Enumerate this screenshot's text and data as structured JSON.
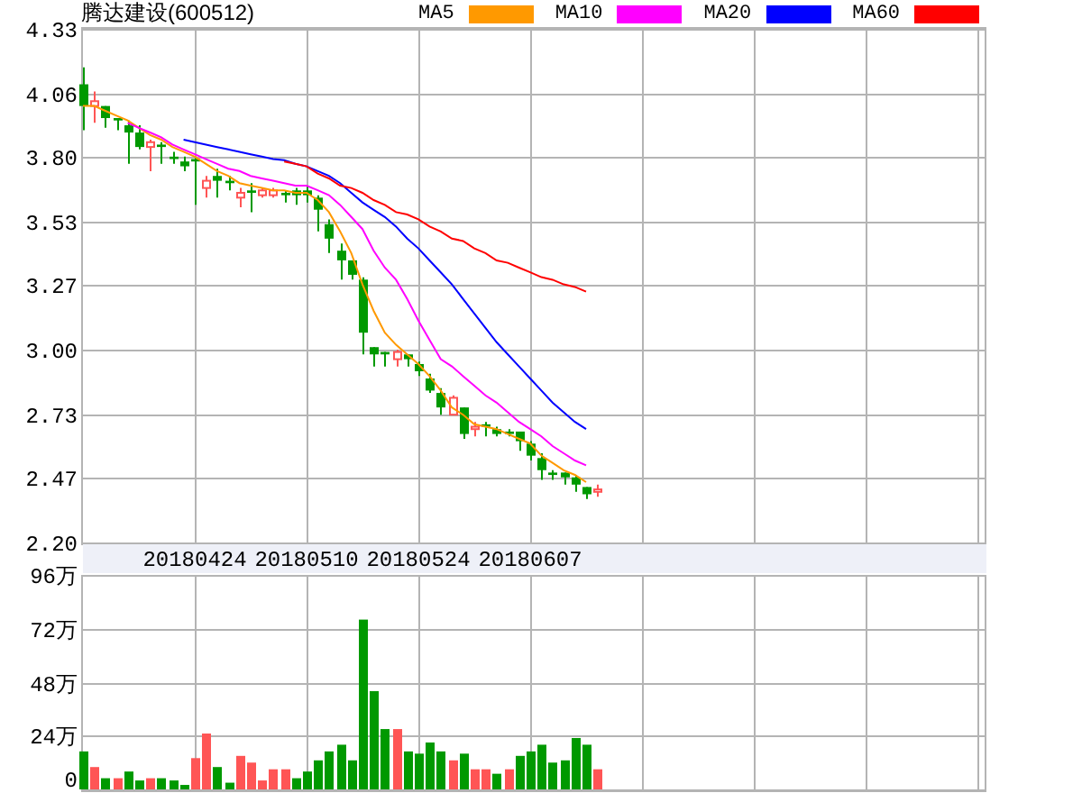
{
  "price_chart": {
    "candles": {
      "chart_data": {
        "type": "candlestick",
        "title": "腾达建设(600512)",
        "grid": true,
        "categories": [
          null,
          null,
          null,
          null,
          null,
          null,
          null,
          null,
          null,
          null,
          "20180424",
          null,
          null,
          null,
          null,
          null,
          null,
          null,
          null,
          null,
          "20180510",
          null,
          null,
          null,
          null,
          null,
          null,
          null,
          null,
          null,
          "20180524",
          null,
          null,
          null,
          null,
          null,
          null,
          null,
          null,
          null,
          "20180607",
          null,
          null,
          null,
          null,
          null,
          null
        ],
        "ylim": [
          2.2,
          4.33
        ],
        "yticks": [
          {
            "value": 4.33,
            "label": "4.33"
          },
          {
            "value": 4.06,
            "label": "4.06"
          },
          {
            "value": 3.8,
            "label": "3.80"
          },
          {
            "value": 3.53,
            "label": "3.53"
          },
          {
            "value": 3.27,
            "label": "3.27"
          },
          {
            "value": 3.0,
            "label": "3.00"
          },
          {
            "value": 2.73,
            "label": "2.73"
          },
          {
            "value": 2.47,
            "label": "2.47"
          },
          {
            "value": 2.2,
            "label": "2.20"
          }
        ],
        "ohlc": [
          [
            4.1,
            4.17,
            3.91,
            4.01
          ],
          [
            4.01,
            4.07,
            3.94,
            4.03
          ],
          [
            4.01,
            4.01,
            3.92,
            3.96
          ],
          [
            3.96,
            3.96,
            3.91,
            3.95
          ],
          [
            3.93,
            3.95,
            3.77,
            3.9
          ],
          [
            3.9,
            3.93,
            3.83,
            3.84
          ],
          [
            3.84,
            3.87,
            3.74,
            3.86
          ],
          [
            3.85,
            3.86,
            3.77,
            3.84
          ],
          [
            3.8,
            3.82,
            3.77,
            3.79
          ],
          [
            3.78,
            3.8,
            3.74,
            3.76
          ],
          [
            3.79,
            3.8,
            3.6,
            3.78
          ],
          [
            3.67,
            3.72,
            3.63,
            3.7
          ],
          [
            3.72,
            3.75,
            3.63,
            3.7
          ],
          [
            3.7,
            3.72,
            3.66,
            3.69
          ],
          [
            3.63,
            3.67,
            3.59,
            3.65
          ],
          [
            3.66,
            3.69,
            3.57,
            3.65
          ],
          [
            3.64,
            3.67,
            3.63,
            3.66
          ],
          [
            3.64,
            3.67,
            3.63,
            3.66
          ],
          [
            3.65,
            3.66,
            3.61,
            3.64
          ],
          [
            3.66,
            3.67,
            3.6,
            3.64
          ],
          [
            3.66,
            3.68,
            3.61,
            3.64
          ],
          [
            3.63,
            3.64,
            3.49,
            3.58
          ],
          [
            3.52,
            3.54,
            3.4,
            3.46
          ],
          [
            3.41,
            3.44,
            3.29,
            3.37
          ],
          [
            3.37,
            3.37,
            3.29,
            3.31
          ],
          [
            3.29,
            3.3,
            2.98,
            3.07
          ],
          [
            3.01,
            3.01,
            2.93,
            2.98
          ],
          [
            2.99,
            2.99,
            2.93,
            2.98
          ],
          [
            2.96,
            3.0,
            2.93,
            2.99
          ],
          [
            2.98,
            2.98,
            2.93,
            2.96
          ],
          [
            2.94,
            2.95,
            2.89,
            2.91
          ],
          [
            2.88,
            2.9,
            2.82,
            2.83
          ],
          [
            2.82,
            2.84,
            2.73,
            2.76
          ],
          [
            2.73,
            2.81,
            2.73,
            2.8
          ],
          [
            2.76,
            2.76,
            2.63,
            2.65
          ],
          [
            2.67,
            2.7,
            2.64,
            2.68
          ],
          [
            2.69,
            2.7,
            2.64,
            2.68
          ],
          [
            2.67,
            2.68,
            2.64,
            2.65
          ],
          [
            2.66,
            2.67,
            2.64,
            2.65
          ],
          [
            2.66,
            2.66,
            2.58,
            2.62
          ],
          [
            2.61,
            2.62,
            2.54,
            2.56
          ],
          [
            2.55,
            2.57,
            2.46,
            2.5
          ],
          [
            2.49,
            2.5,
            2.46,
            2.48
          ],
          [
            2.49,
            2.49,
            2.44,
            2.47
          ],
          [
            2.47,
            2.48,
            2.41,
            2.44
          ],
          [
            2.43,
            2.43,
            2.38,
            2.4
          ],
          [
            2.41,
            2.44,
            2.39,
            2.42
          ]
        ]
      }
    },
    "moving_averages": {
      "chart_data": {
        "type": "line",
        "ylim": [
          2.2,
          4.33
        ],
        "series": [
          {
            "name": "MA5",
            "color": "#ff9900",
            "values": [
              4.01,
              4.01,
              3.99,
              3.97,
              3.95,
              3.92,
              3.89,
              3.87,
              3.84,
              3.82,
              3.8,
              3.77,
              3.74,
              3.72,
              3.69,
              3.68,
              3.67,
              3.66,
              3.66,
              3.65,
              3.65,
              3.62,
              3.57,
              3.49,
              3.4,
              3.27,
              3.16,
              3.07,
              3.02,
              2.98,
              2.94,
              2.89,
              2.83,
              2.76,
              2.73,
              2.69,
              2.68,
              2.67,
              2.65,
              2.63,
              2.61,
              2.56,
              2.53,
              2.5,
              2.48,
              2.45,
              null
            ]
          },
          {
            "name": "MA10",
            "color": "#ff00ff",
            "values": [
              null,
              null,
              null,
              null,
              3.94,
              3.92,
              3.9,
              3.88,
              3.85,
              3.83,
              3.81,
              3.79,
              3.77,
              3.75,
              3.74,
              3.72,
              3.71,
              3.7,
              3.69,
              3.68,
              3.68,
              3.66,
              3.64,
              3.6,
              3.55,
              3.5,
              3.41,
              3.34,
              3.29,
              3.21,
              3.12,
              3.04,
              2.96,
              2.93,
              2.89,
              2.85,
              2.81,
              2.78,
              2.74,
              2.7,
              2.67,
              2.64,
              2.6,
              2.57,
              2.54,
              2.52,
              null
            ]
          },
          {
            "name": "MA20",
            "color": "#0000ff",
            "values": [
              null,
              null,
              null,
              null,
              null,
              null,
              null,
              null,
              null,
              3.87,
              3.86,
              3.85,
              3.84,
              3.83,
              3.82,
              3.81,
              3.8,
              3.79,
              3.785,
              3.77,
              3.76,
              3.74,
              3.72,
              3.69,
              3.65,
              3.61,
              3.58,
              3.55,
              3.51,
              3.46,
              3.42,
              3.37,
              3.32,
              3.27,
              3.21,
              3.15,
              3.09,
              3.03,
              2.98,
              2.93,
              2.88,
              2.83,
              2.78,
              2.74,
              2.7,
              2.67,
              null
            ]
          },
          {
            "name": "MA60",
            "color": "#ff0000",
            "values": [
              null,
              null,
              null,
              null,
              null,
              null,
              null,
              null,
              null,
              null,
              null,
              null,
              null,
              null,
              null,
              null,
              null,
              null,
              3.78,
              3.77,
              3.76,
              3.73,
              3.71,
              3.68,
              3.67,
              3.65,
              3.62,
              3.6,
              3.57,
              3.56,
              3.54,
              3.51,
              3.49,
              3.46,
              3.45,
              3.42,
              3.4,
              3.37,
              3.36,
              3.34,
              3.32,
              3.3,
              3.29,
              3.27,
              3.26,
              3.24,
              null
            ]
          }
        ]
      }
    }
  },
  "volume_chart": {
    "chart_data": {
      "type": "bar",
      "grid": true,
      "stacked": true,
      "ylim": [
        0,
        96
      ],
      "yticks": [
        {
          "value": 96,
          "label": "96万"
        },
        {
          "value": 72,
          "label": "72万"
        },
        {
          "value": 48,
          "label": "48万"
        },
        {
          "value": 24,
          "label": "24万"
        },
        {
          "value": 0,
          "label": "0"
        }
      ],
      "series": [
        {
          "color": "#ff5555",
          "values": [
            null,
            10,
            null,
            5,
            null,
            null,
            5,
            null,
            null,
            null,
            14,
            25,
            null,
            null,
            15,
            12,
            4,
            9,
            9,
            null,
            null,
            null,
            null,
            null,
            null,
            null,
            null,
            null,
            27,
            null,
            null,
            null,
            null,
            13,
            null,
            9,
            9,
            null,
            9,
            null,
            null,
            null,
            null,
            null,
            null,
            null,
            9
          ]
        },
        {
          "color": "#009900",
          "values": [
            17,
            null,
            5,
            null,
            8,
            4,
            null,
            5,
            4,
            2,
            null,
            null,
            10,
            3,
            null,
            null,
            null,
            null,
            null,
            5,
            8,
            13,
            17,
            20,
            13,
            76,
            44,
            27,
            null,
            17,
            16,
            21,
            17,
            null,
            16,
            null,
            null,
            7,
            null,
            15,
            17,
            20,
            12,
            13,
            23,
            20,
            null
          ]
        }
      ]
    }
  }
}
